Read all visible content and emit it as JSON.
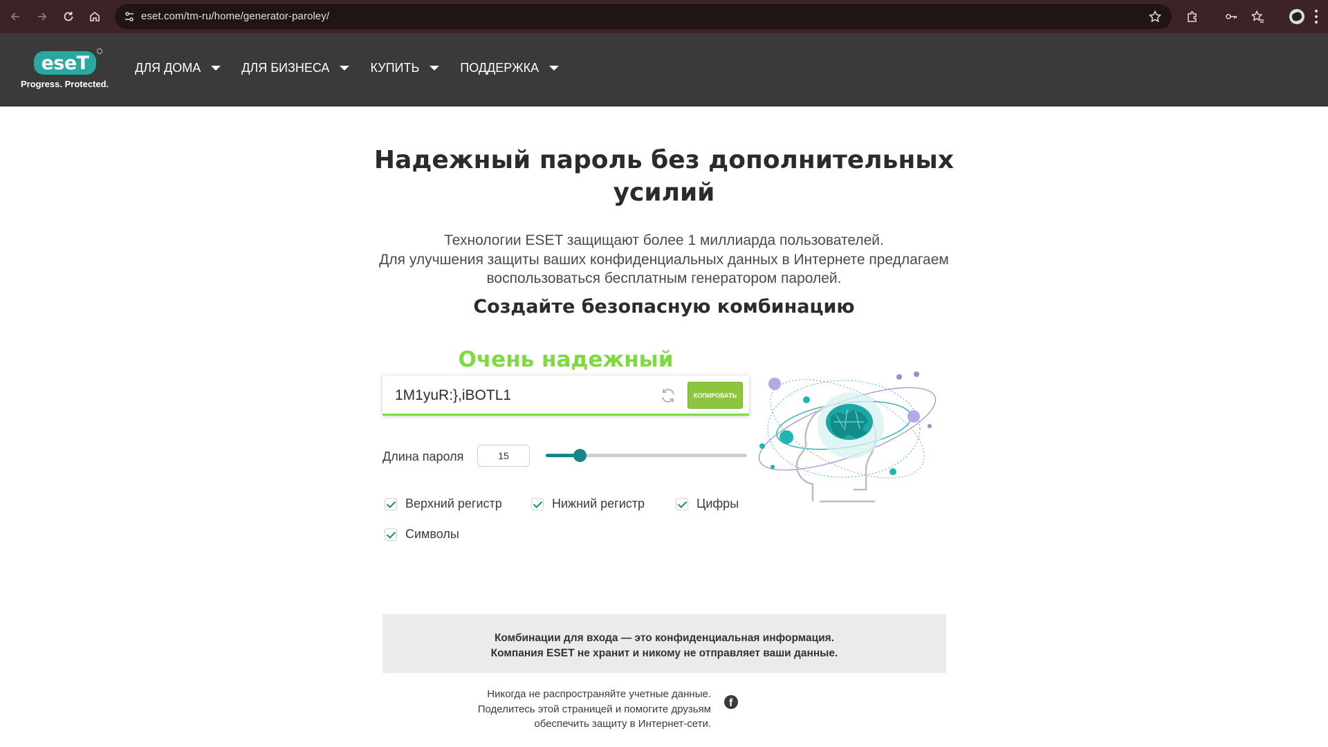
{
  "browser": {
    "url": "eset.com/tm-ru/home/generator-paroley/"
  },
  "header": {
    "logo_text": "eseT",
    "tagline": "Progress. Protected.",
    "nav": [
      {
        "label": "ДЛЯ ДОМА"
      },
      {
        "label": "ДЛЯ БИЗНЕСА"
      },
      {
        "label": "КУПИТЬ"
      },
      {
        "label": "ПОДДЕРЖКА"
      }
    ]
  },
  "main": {
    "title_line1": "Надежный пароль без дополнительных",
    "title_line2": "усилий",
    "intro_line1": "Технологии ESET защищают более 1 миллиарда пользователей.",
    "intro_line2": "Для улучшения защиты ваших конфиденциальных данных в Интернете предлагаем",
    "intro_line3": "воспользоваться бесплатным генератором паролей.",
    "subheading": "Создайте безопасную комбинацию"
  },
  "generator": {
    "strength_label": "Очень надежный",
    "strength_color": "#7edb3f",
    "password": "1M1yuR:},iBOTL1",
    "copy_label": "КОПИРОВАТЬ",
    "length_label": "Длина пароля",
    "length_value": "15",
    "length_fraction": 0.17,
    "options": [
      {
        "label": "Верхний регистр",
        "checked": true
      },
      {
        "label": "Нижний регистр",
        "checked": true
      },
      {
        "label": "Цифры",
        "checked": true
      },
      {
        "label": "Символы",
        "checked": true
      }
    ]
  },
  "notice": {
    "line1": "Комбинации для входа — это конфиденциальная информация.",
    "line2": "Компания ESET не хранит и никому не отправляет ваши данные."
  },
  "share": {
    "line1": "Никогда не распространяйте учетные данные.",
    "line2": "Поделитесь этой страницей и помогите друзьям",
    "line3": "обеспечить защиту в Интернет-сети.",
    "icon": "facebook-icon"
  },
  "colors": {
    "brand_teal": "#2aa8a0",
    "accent_green": "#8cc63f",
    "slider_teal": "#16858a",
    "header_bg": "#3a3a3a",
    "chrome_bg": "#3b2327"
  }
}
